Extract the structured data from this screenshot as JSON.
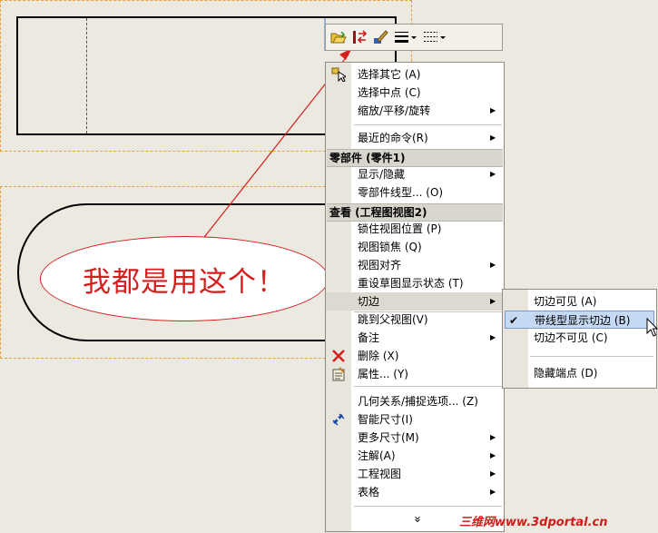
{
  "toolbar": {
    "buttons": [
      {
        "icon": "open-folder-icon"
      },
      {
        "icon": "swap-arrows-icon"
      },
      {
        "icon": "edit-brush-icon"
      },
      {
        "icon": "line-thickness-icon",
        "has_dropdown": true
      },
      {
        "icon": "line-style-icon",
        "has_dropdown": true
      }
    ]
  },
  "callout": {
    "text": "我都是用这个！",
    "color": "#d41f1f"
  },
  "context_menu": {
    "items_top": [
      {
        "label": "选择其它 (A)",
        "icon": "select-other-icon"
      },
      {
        "label": "选择中点 (C)"
      },
      {
        "label": "缩放/平移/旋转",
        "submenu": true
      },
      {
        "label": "最近的命令(R)",
        "submenu": true
      }
    ],
    "section1": {
      "header": "零部件 (零件1)",
      "items": [
        {
          "label": "显示/隐藏",
          "submenu": true
        },
        {
          "label": "零部件线型... (O)"
        }
      ]
    },
    "section2": {
      "header": "查看 (工程图视图2)",
      "items": [
        {
          "label": "锁住视图位置 (P)"
        },
        {
          "label": "视图锁焦 (Q)"
        },
        {
          "label": "视图对齐",
          "submenu": true
        },
        {
          "label": "重设草图显示状态 (T)"
        },
        {
          "label": "切边",
          "submenu": true,
          "active": true
        },
        {
          "label": "跳到父视图(V)"
        },
        {
          "label": "备注",
          "submenu": true
        },
        {
          "label": "删除 (X)",
          "icon": "delete-x-icon"
        },
        {
          "label": "属性... (Y)",
          "icon": "properties-icon"
        }
      ]
    },
    "items_bottom": [
      {
        "label": "几何关系/捕捉选项... (Z)"
      },
      {
        "label": "智能尺寸(I)",
        "icon": "smart-dimension-icon"
      },
      {
        "label": "更多尺寸(M)",
        "submenu": true
      },
      {
        "label": "注解(A)",
        "submenu": true
      },
      {
        "label": "工程视图",
        "submenu": true
      },
      {
        "label": "表格",
        "submenu": true
      }
    ],
    "expand_glyph": "»"
  },
  "tangent_edge_submenu": {
    "items": [
      {
        "label": "切边可见 (A)"
      },
      {
        "label": "带线型显示切边 (B)",
        "checked": true,
        "highlighted": true
      },
      {
        "label": "切边不可见 (C)"
      },
      {
        "label": "隐藏端点 (D)"
      }
    ]
  },
  "watermark": "三维网www.3dportal.cn",
  "colors": {
    "accent_red": "#d41f1f",
    "selection_dash": "#e8a040",
    "highlight": "#c6d9f2"
  }
}
